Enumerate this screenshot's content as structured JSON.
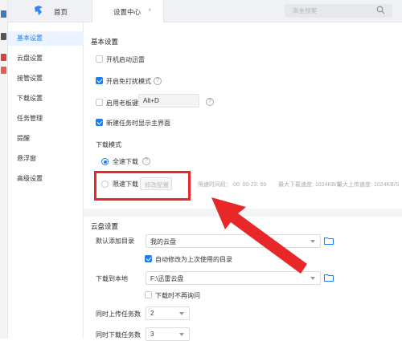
{
  "topbar": {
    "home_label": "首页",
    "tab_label": "设置中心",
    "tab_close": "×",
    "search_placeholder": "高金预案"
  },
  "sidebar": {
    "items": [
      {
        "label": "基本设置",
        "active": true
      },
      {
        "label": "云盘设置"
      },
      {
        "label": "接管设置"
      },
      {
        "label": "下载设置"
      },
      {
        "label": "任务管理"
      },
      {
        "label": "提醒"
      },
      {
        "label": "悬浮窗"
      },
      {
        "label": "高级设置"
      }
    ]
  },
  "basic": {
    "title": "基本设置",
    "autostart": {
      "label": "开机启动迅雷",
      "checked": false
    },
    "no_disturb": {
      "label": "开启免打扰模式",
      "checked": true
    },
    "boss_key": {
      "label": "启用老板键",
      "checked": false,
      "value": "Alt+D"
    },
    "show_main": {
      "label": "新建任务时显示主界面",
      "checked": true
    },
    "download_mode": {
      "title": "下载模式",
      "full_speed": {
        "label": "全速下载",
        "selected": true
      },
      "limited": {
        "label": "限速下载",
        "selected": false,
        "edit_btn": "修改配置",
        "period": "限速时间段： 00: 00-23: 59",
        "max_download": "最大下载速度: 1024KB/S",
        "max_upload": "最大上传速度: 1024KB/S"
      }
    }
  },
  "cloud": {
    "title": "云盘设置",
    "default_dir": {
      "label": "默认添加目录",
      "value": "我的云盘"
    },
    "auto_modify": {
      "label": "自动修改为上次使用的目录",
      "checked": true
    },
    "download_local": {
      "label": "下载到本地",
      "value": "F:\\迅雷云盘"
    },
    "no_ask": {
      "label": "下载时不再询问",
      "checked": false
    },
    "upload_count": {
      "label": "同时上传任务数",
      "value": "2"
    },
    "download_count": {
      "label": "同时下载任务数",
      "value": "3"
    }
  },
  "colors": {
    "accent": "#1e7df5",
    "annotation": "#e82828"
  }
}
